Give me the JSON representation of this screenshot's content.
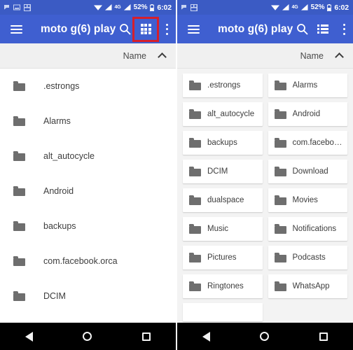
{
  "status_bar": {
    "notification_icons": [
      "flag-icon",
      "image-icon",
      "screenshot-icon"
    ],
    "wifi_icon": "wifi-icon",
    "signal_icon": "cell-signal-icon",
    "network_label": "4G",
    "signal2_icon": "cell-signal2-icon",
    "battery_percent": "52%",
    "battery_icon": "battery-icon",
    "time": "6:02"
  },
  "accent_colors": {
    "appbar_blue": "#3f5fd0",
    "statusbar_blue": "#3b5bc4",
    "highlight_red": "#d51f2c",
    "folder_gray": "#6e6e6e",
    "sortbar_gray": "#f0f0f0",
    "grid_bg_gray": "#f3f3f3"
  },
  "left_screen": {
    "appbar": {
      "menu_icon": "hamburger-menu-icon",
      "title": "moto g(6) play",
      "search_icon": "search-icon",
      "view_toggle_icon": "grid-view-icon",
      "view_toggle_highlighted": true,
      "overflow_icon": "overflow-menu-icon"
    },
    "sort_bar": {
      "label": "Name",
      "direction_icon": "chevron-up-icon"
    },
    "items": [
      {
        "name": ".estrongs",
        "icon": "folder-icon"
      },
      {
        "name": "Alarms",
        "icon": "folder-icon"
      },
      {
        "name": "alt_autocycle",
        "icon": "folder-icon"
      },
      {
        "name": "Android",
        "icon": "folder-icon"
      },
      {
        "name": "backups",
        "icon": "folder-icon"
      },
      {
        "name": "com.facebook.orca",
        "icon": "folder-icon"
      },
      {
        "name": "DCIM",
        "icon": "folder-icon"
      }
    ],
    "nav_bar": {
      "back_icon": "back-triangle-icon",
      "home_icon": "home-circle-icon",
      "recents_icon": "recents-square-icon"
    }
  },
  "right_screen": {
    "appbar": {
      "menu_icon": "hamburger-menu-icon",
      "title": "moto g(6) play",
      "search_icon": "search-icon",
      "view_toggle_icon": "list-view-icon",
      "view_toggle_highlighted": false,
      "overflow_icon": "overflow-menu-icon"
    },
    "sort_bar": {
      "label": "Name",
      "direction_icon": "chevron-up-icon"
    },
    "items": [
      {
        "name": ".estrongs",
        "icon": "folder-icon"
      },
      {
        "name": "Alarms",
        "icon": "folder-icon"
      },
      {
        "name": "alt_autocycle",
        "icon": "folder-icon"
      },
      {
        "name": "Android",
        "icon": "folder-icon"
      },
      {
        "name": "backups",
        "icon": "folder-icon"
      },
      {
        "name": "com.facebo…",
        "icon": "folder-icon"
      },
      {
        "name": "DCIM",
        "icon": "folder-icon"
      },
      {
        "name": "Download",
        "icon": "folder-icon"
      },
      {
        "name": "dualspace",
        "icon": "folder-icon"
      },
      {
        "name": "Movies",
        "icon": "folder-icon"
      },
      {
        "name": "Music",
        "icon": "folder-icon"
      },
      {
        "name": "Notifications",
        "icon": "folder-icon"
      },
      {
        "name": "Pictures",
        "icon": "folder-icon"
      },
      {
        "name": "Podcasts",
        "icon": "folder-icon"
      },
      {
        "name": "Ringtones",
        "icon": "folder-icon"
      },
      {
        "name": "WhatsApp",
        "icon": "folder-icon"
      },
      {
        "name": "",
        "icon": "folder-icon"
      }
    ],
    "nav_bar": {
      "back_icon": "back-triangle-icon",
      "home_icon": "home-circle-icon",
      "recents_icon": "recents-square-icon"
    }
  }
}
